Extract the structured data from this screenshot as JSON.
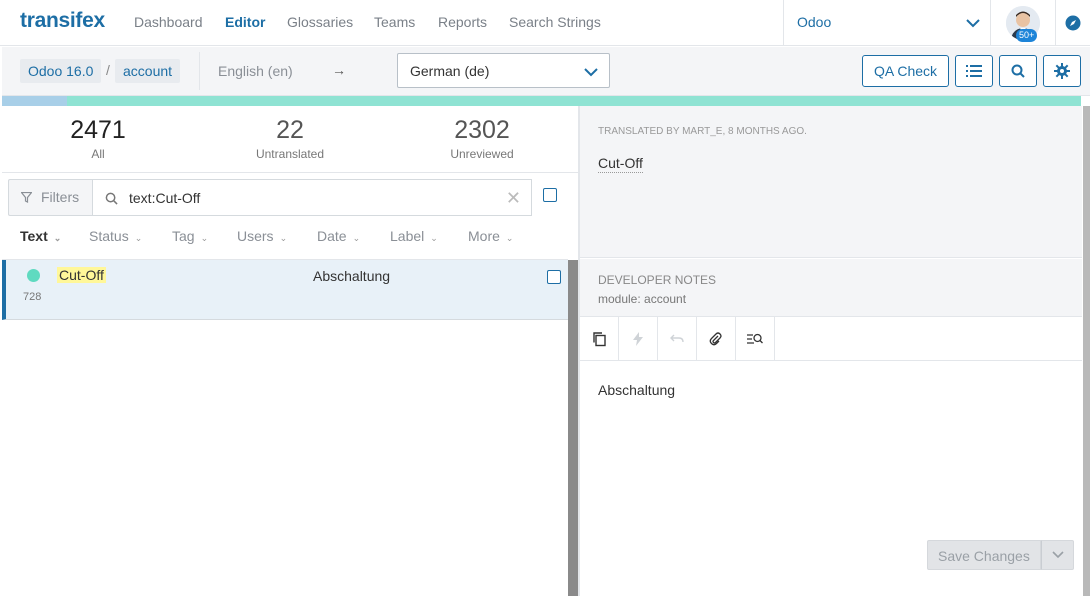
{
  "brand": {
    "logo": "transifex",
    "accent": "#1d6ea5"
  },
  "nav": {
    "items": [
      "Dashboard",
      "Editor",
      "Glossaries",
      "Teams",
      "Reports",
      "Search Strings"
    ],
    "active": "Editor"
  },
  "project_selector": {
    "label": "Odoo"
  },
  "user": {
    "notification_badge": "50+"
  },
  "toolbar": {
    "breadcrumb": [
      "Odoo 16.0",
      "account"
    ],
    "separator": "/",
    "source_language": "English (en)",
    "arrow": "→",
    "target_language": "German (de)",
    "qa_check": "QA Check"
  },
  "progress": {
    "reviewed_fraction": 0.06
  },
  "stats": [
    {
      "value": "2471",
      "label": "All"
    },
    {
      "value": "22",
      "label": "Untranslated"
    },
    {
      "value": "2302",
      "label": "Unreviewed"
    }
  ],
  "filters": {
    "label": "Filters",
    "search_value": "text:Cut-Off",
    "clear": "✕"
  },
  "sort_columns": [
    "Text",
    "Status",
    "Tag",
    "Users",
    "Date",
    "Label",
    "More"
  ],
  "strings": [
    {
      "source": "Cut-Off",
      "id": "728",
      "translation": "Abschaltung",
      "status_color": "#5fdac0"
    }
  ],
  "detail": {
    "translated_by": "Translated by mart_e, 8 months ago.",
    "source_text": "Cut-Off",
    "developer_notes_header": "DEVELOPER NOTES",
    "developer_notes": "module: account",
    "translation_text": "Abschaltung",
    "save_label": "Save Changes"
  }
}
